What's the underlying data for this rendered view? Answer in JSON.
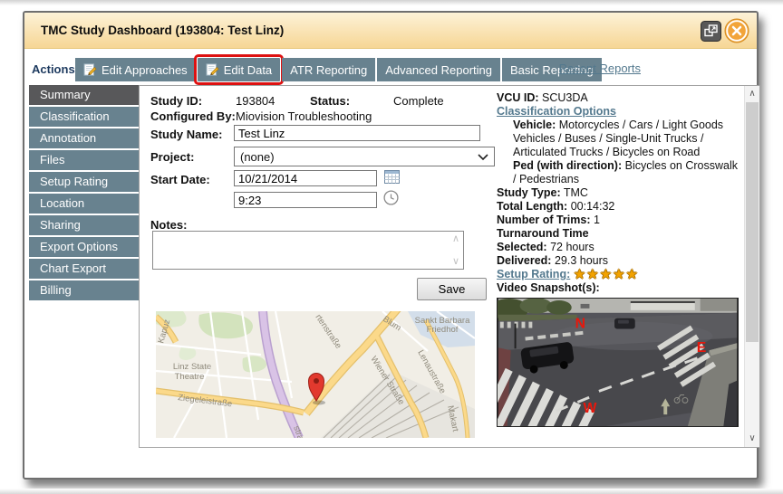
{
  "window": {
    "title": "TMC Study Dashboard (193804: Test Linz)"
  },
  "actions": {
    "label": "Actions:",
    "tabs": [
      {
        "label": "Edit Approaches",
        "highlighted": false
      },
      {
        "label": "Edit Data",
        "highlighted": true
      },
      {
        "label": "ATR Reporting",
        "highlighted": false
      },
      {
        "label": "Advanced Reporting",
        "highlighted": false
      },
      {
        "label": "Basic Reporting",
        "highlighted": false
      }
    ],
    "recent_reports_link": "Recent Reports"
  },
  "sidebar": {
    "items": [
      {
        "label": "Summary",
        "active": true
      },
      {
        "label": "Classification",
        "active": false
      },
      {
        "label": "Annotation",
        "active": false
      },
      {
        "label": "Files",
        "active": false
      },
      {
        "label": "Setup Rating",
        "active": false
      },
      {
        "label": "Location",
        "active": false
      },
      {
        "label": "Sharing",
        "active": false
      },
      {
        "label": "Export Options",
        "active": false
      },
      {
        "label": "Chart Export",
        "active": false
      },
      {
        "label": "Billing",
        "active": false
      }
    ]
  },
  "form": {
    "study_id_label": "Study ID:",
    "study_id": "193804",
    "status_label": "Status:",
    "status": "Complete",
    "configured_by_label": "Configured By:",
    "configured_by": "Miovision Troubleshooting",
    "study_name_label": "Study Name:",
    "study_name": "Test Linz",
    "project_label": "Project:",
    "project_selected": "(none)",
    "start_date_label": "Start Date:",
    "start_date": "10/21/2014",
    "start_time": "9:23",
    "notes_label": "Notes:",
    "notes": "",
    "save_label": "Save"
  },
  "details": {
    "vcu_id_label": "VCU ID:",
    "vcu_id": "SCU3DA",
    "classification_options_link": "Classification Options",
    "vehicle_label": "Vehicle:",
    "vehicle_value": "Motorcycles / Cars / Light Goods Vehicles / Buses / Single-Unit Trucks / Articulated Trucks / Bicycles on Road",
    "ped_label": "Ped (with direction):",
    "ped_value": "Bicycles on Crosswalk / Pedestrians",
    "study_type_label": "Study Type:",
    "study_type": "TMC",
    "total_length_label": "Total Length:",
    "total_length": "00:14:32",
    "trims_label": "Number of Trims:",
    "trims": "1",
    "turnaround_label": "Turnaround Time",
    "selected_label": "Selected:",
    "selected": "72 hours",
    "delivered_label": "Delivered:",
    "delivered": "29.3 hours",
    "setup_rating_link": "Setup Rating:",
    "rating_value": 5,
    "rating_stars": "★★★★★"
  },
  "map": {
    "labels": {
      "kapuz": "Kapuz",
      "gartenstrasse": "rtenstraße",
      "blumau": "Blum",
      "sankt_barbara_1": "Sankt Barbara",
      "sankt_barbara_2": "Friedhof",
      "linz_state_1": "Linz State",
      "linz_state_2": "Theatre",
      "ziegeleistrasse": "Ziegeleistraße",
      "wiener_strasse": "Wiener Straße",
      "lenaustrasse": "Lenaustraße",
      "makart": "Makart",
      "strasse_partial": "straße"
    }
  },
  "video": {
    "label": "Video Snapshot(s):",
    "direction_n": "N",
    "direction_e": "E",
    "direction_w": "W"
  },
  "colors": {
    "titlebar": "#f8dfa6",
    "tab_bg": "#68828f",
    "sidebar_active": "#58585a",
    "highlight_red": "#dd1111",
    "link": "#54798e",
    "star_gold": "#f2a200",
    "actions_text": "#1d3a5f"
  },
  "icons": [
    "edit-icon",
    "calendar-icon",
    "clock-icon",
    "popout-icon",
    "close-icon",
    "star-icon",
    "dropdown-arrow-icon",
    "scroll-up-icon",
    "scroll-down-icon",
    "map-pin-icon"
  ]
}
